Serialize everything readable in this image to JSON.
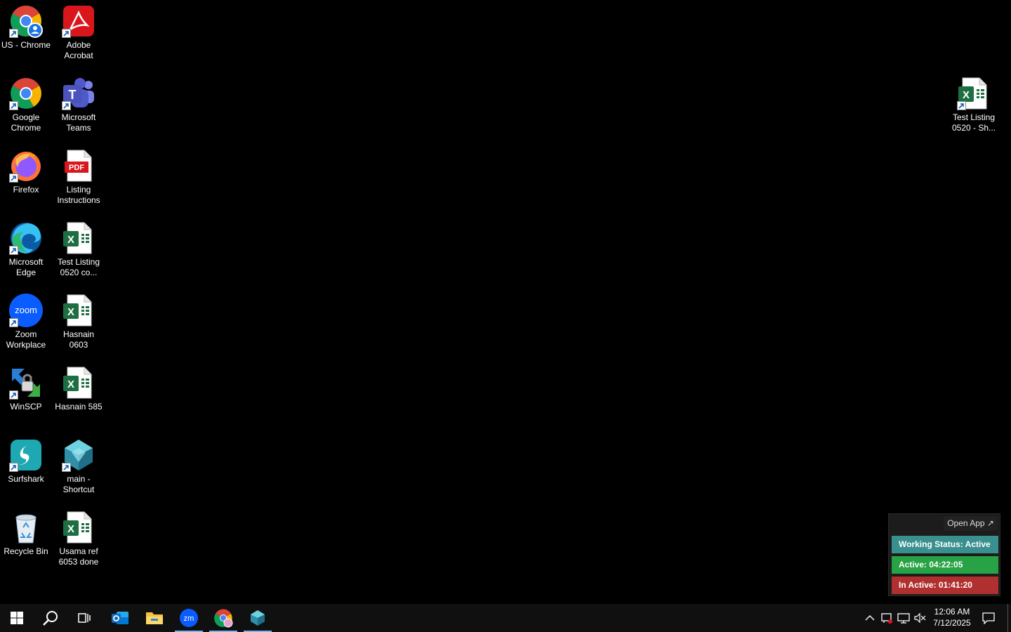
{
  "desktop": {
    "icons": [
      {
        "label": "US - Chrome",
        "icon": "chrome-profile-icon"
      },
      {
        "label": "Adobe\nAcrobat",
        "icon": "adobe-acrobat-icon"
      },
      {
        "label": "Google\nChrome",
        "icon": "chrome-icon"
      },
      {
        "label": "Microsoft\nTeams",
        "icon": "teams-icon"
      },
      {
        "label": "Firefox",
        "icon": "firefox-icon"
      },
      {
        "label": "Listing\nInstructions",
        "icon": "pdf-file-icon"
      },
      {
        "label": "Microsoft\nEdge",
        "icon": "edge-icon"
      },
      {
        "label": "Test Listing\n0520 co...",
        "icon": "excel-file-icon"
      },
      {
        "label": "Zoom\nWorkplace",
        "icon": "zoom-icon"
      },
      {
        "label": "Hasnain 0603",
        "icon": "excel-file-icon"
      },
      {
        "label": "WinSCP",
        "icon": "winscp-icon"
      },
      {
        "label": "Hasnain 585",
        "icon": "excel-file-icon"
      },
      {
        "label": "Surfshark",
        "icon": "surfshark-icon"
      },
      {
        "label": "main -\nShortcut",
        "icon": "main-app-icon"
      },
      {
        "label": "Recycle Bin",
        "icon": "recycle-bin-icon"
      },
      {
        "label": "Usama ref\n6053 done",
        "icon": "excel-file-icon"
      },
      {
        "label": "Test Listing\n0520 - Sh...",
        "icon": "excel-file-icon"
      }
    ]
  },
  "widget": {
    "open_app_label": "Open App ↗",
    "working_status": "Working Status: Active",
    "active_time": "Active: 04:22:05",
    "inactive_time": "In Active: 01:41:20",
    "colors": {
      "working": "#3a8f8f",
      "active": "#27a244",
      "inactive": "#b0302f"
    }
  },
  "taskbar": {
    "buttons": [
      {
        "icon": "windows-start-icon"
      },
      {
        "icon": "search-icon"
      },
      {
        "icon": "task-view-icon"
      },
      {
        "icon": "outlook-icon"
      },
      {
        "icon": "file-explorer-icon"
      },
      {
        "icon": "zoom-taskbar-icon"
      },
      {
        "icon": "chrome-taskbar-icon"
      },
      {
        "icon": "main-app-taskbar-icon"
      }
    ],
    "tray": {
      "icons": [
        "chevron-up-icon",
        "network-alert-icon",
        "network-icon",
        "volume-muted-icon",
        "notification-icon"
      ]
    },
    "clock": {
      "time": "12:06 AM",
      "date": "7/12/2025"
    },
    "accent": "#76b9ed"
  }
}
